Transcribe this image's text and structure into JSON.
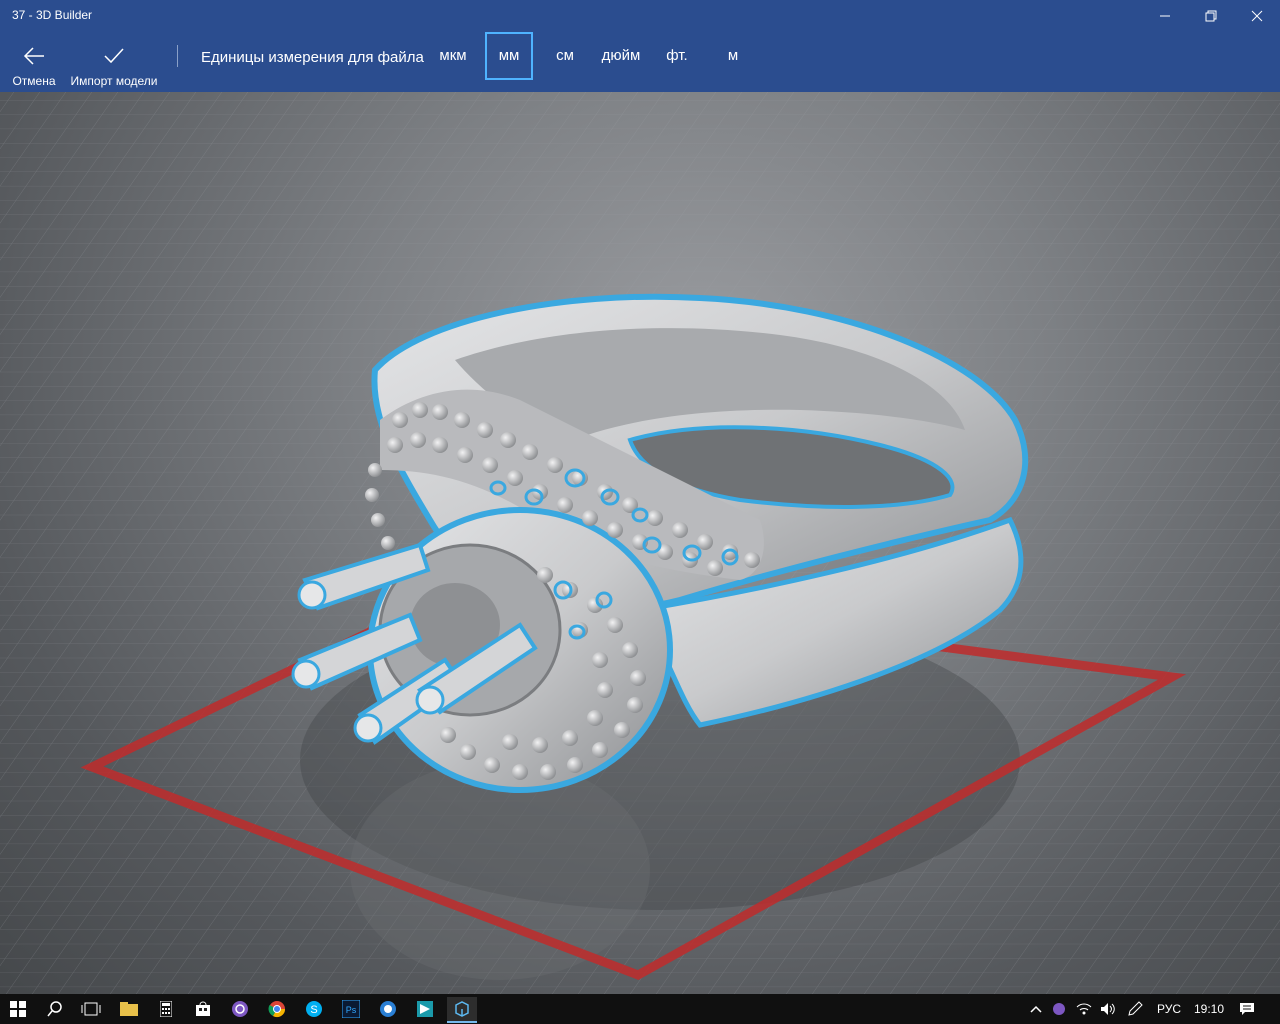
{
  "window": {
    "title": "37 - 3D Builder"
  },
  "toolbar": {
    "cancel_label": "Отмена",
    "import_label": "Импорт модели",
    "units_label": "Единицы измерения для файла",
    "units": [
      "мкм",
      "мм",
      "см",
      "дюйм",
      "фт.",
      "м"
    ],
    "selected_unit": "мм"
  },
  "colors": {
    "accent": "#2b4d8f",
    "selection": "#4fb3ff",
    "platform": "#c02b2b",
    "model": "#cfd0d2"
  },
  "taskbar": {
    "apps": [
      "start-icon",
      "search-icon",
      "task-view-icon",
      "file-explorer-icon",
      "calculator-icon",
      "store-icon",
      "viber-icon",
      "chrome-icon",
      "skype-icon",
      "photoshop-icon",
      "app-icon",
      "app-icon",
      "3d-builder-icon"
    ],
    "language": "РУС",
    "time": "19:10"
  }
}
